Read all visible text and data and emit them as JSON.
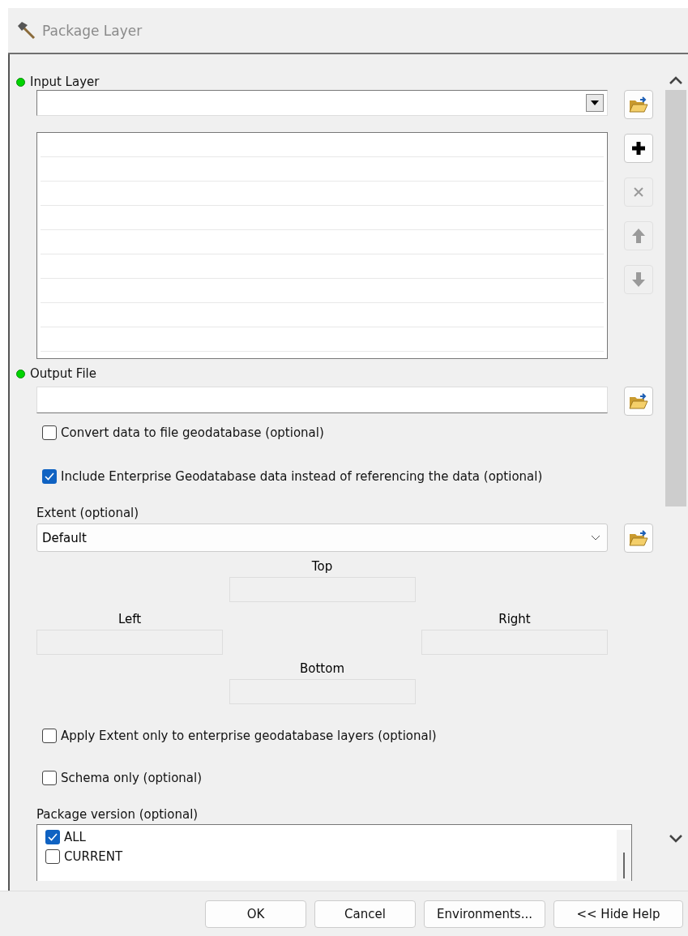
{
  "window": {
    "title": "Package Layer"
  },
  "input_layer": {
    "label": "Input Layer",
    "required": true,
    "list_tools": [
      {
        "kind": "add",
        "disabled": false
      },
      {
        "kind": "remove",
        "disabled": true
      },
      {
        "kind": "up",
        "disabled": true
      },
      {
        "kind": "down",
        "disabled": true
      }
    ]
  },
  "output_file": {
    "label": "Output File",
    "required": true
  },
  "options": [
    {
      "label": "Convert data to file geodatabase (optional)",
      "checked": false
    },
    {
      "label": "Include Enterprise Geodatabase data instead of referencing the data (optional)",
      "checked": true
    }
  ],
  "extent": {
    "label": "Extent (optional)",
    "value": "Default",
    "top": "Top",
    "left": "Left",
    "right": "Right",
    "bottom": "Bottom"
  },
  "options_2": [
    {
      "label": "Apply Extent only to enterprise geodatabase layers (optional)",
      "checked": false
    },
    {
      "label": "Schema only (optional)",
      "checked": false
    }
  ],
  "package_version": {
    "label": "Package version (optional)",
    "items": [
      {
        "label": "ALL",
        "checked": true
      },
      {
        "label": "CURRENT",
        "checked": false
      }
    ]
  },
  "buttons": [
    "OK",
    "Cancel",
    "Environments...",
    "<< Hide Help"
  ]
}
